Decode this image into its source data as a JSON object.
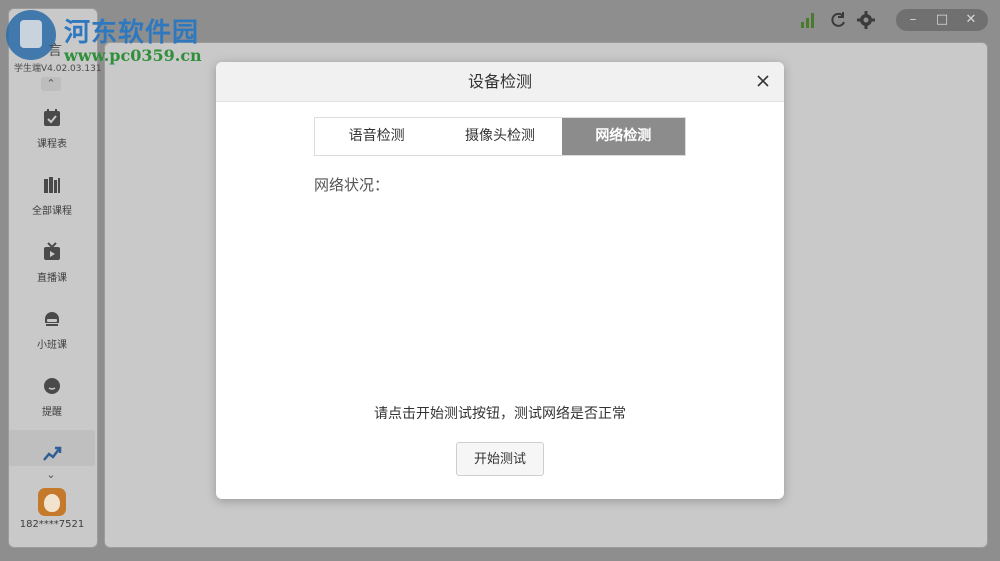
{
  "watermark": {
    "title": "河东软件园",
    "url": "www.pc0359.cn"
  },
  "app": {
    "brand_text": "言",
    "version": "学生端V4.02.03.131"
  },
  "sidebar": {
    "items": [
      {
        "label": "课程表",
        "icon": "calendar-check-icon"
      },
      {
        "label": "全部课程",
        "icon": "books-icon"
      },
      {
        "label": "直播课",
        "icon": "live-tv-icon"
      },
      {
        "label": "小班课",
        "icon": "small-class-icon"
      },
      {
        "label": "提醒",
        "icon": "chat-bubble-icon"
      },
      {
        "label": "",
        "icon": "trend-chart-icon"
      }
    ],
    "user_phone": "182****7521"
  },
  "topbar": {
    "icons": [
      "signal-icon",
      "refresh-icon",
      "settings-icon"
    ],
    "window_controls": [
      "minimize-icon",
      "maximize-icon",
      "close-icon"
    ],
    "window_glyphs": [
      "–",
      "□",
      "✕"
    ]
  },
  "dialog": {
    "title": "设备检测",
    "close_glyph": "✕",
    "tabs": [
      "语音检测",
      "摄像头检测",
      "网络检测"
    ],
    "active_tab": 2,
    "network_status_label": "网络状况：",
    "hint": "请点击开始测试按钮，测试网络是否正常",
    "start_button": "开始测试"
  },
  "colors": {
    "accent_active_tab": "#8c8c8c",
    "signal_green": "#4a7a2c"
  }
}
